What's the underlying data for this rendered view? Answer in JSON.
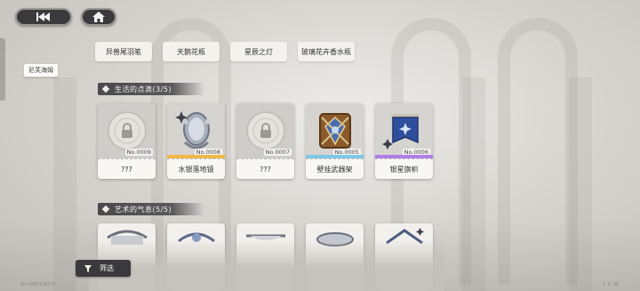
{
  "nav": {
    "back_icon": "back-arrow-icon",
    "home_icon": "home-icon"
  },
  "character_tag": "尼芙海姆",
  "top_items": [
    "异兽尾羽笔",
    "天鹅花瓶",
    "星辰之灯",
    "玻璃花卉香水瓶"
  ],
  "sections": [
    {
      "title": "生活的点滴(3/5)",
      "cards": [
        {
          "number": "No.0009",
          "name": "???",
          "locked": true,
          "rarity_color": ""
        },
        {
          "number": "No.0008",
          "name": "水银落地镜",
          "locked": false,
          "rarity_color": "#f0b84a"
        },
        {
          "number": "No.0007",
          "name": "???",
          "locked": true,
          "rarity_color": ""
        },
        {
          "number": "No.0005",
          "name": "壁挂武器架",
          "locked": false,
          "rarity_color": "#7ec8e8"
        },
        {
          "number": "No.0006",
          "name": "银星旗帜",
          "locked": false,
          "rarity_color": "#b07ee8"
        }
      ]
    },
    {
      "title": "艺术的气息(5/5)"
    }
  ],
  "filter": {
    "label": "筛选",
    "icon": "filter-funnel-icon"
  },
  "footer": {
    "uid": "ID:4285156779",
    "version": "1.0.36"
  },
  "colors": {
    "accent_dark": "#3a3a3c",
    "rarity_gold": "#f0b84a",
    "rarity_blue": "#7ec8e8",
    "rarity_purple": "#b07ee8"
  }
}
